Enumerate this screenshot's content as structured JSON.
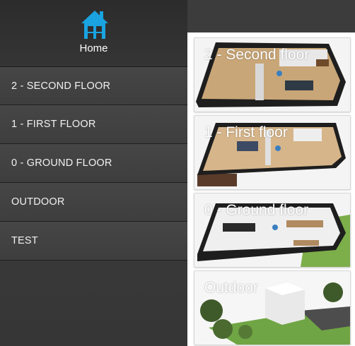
{
  "header": {
    "home_label": "Home",
    "home_icon": "house-icon",
    "accent": "#1aa3e0"
  },
  "menu": {
    "items": [
      {
        "label": "2 - SECOND FLOOR"
      },
      {
        "label": "1 - FIRST FLOOR"
      },
      {
        "label": "0 - GROUND FLOOR"
      },
      {
        "label": "OUTDOOR"
      },
      {
        "label": "TEST"
      }
    ]
  },
  "cards": [
    {
      "label": "2 - Second floor"
    },
    {
      "label": "1 - First floor"
    },
    {
      "label": "0 - Ground floor"
    },
    {
      "label": "Outdoor"
    }
  ]
}
